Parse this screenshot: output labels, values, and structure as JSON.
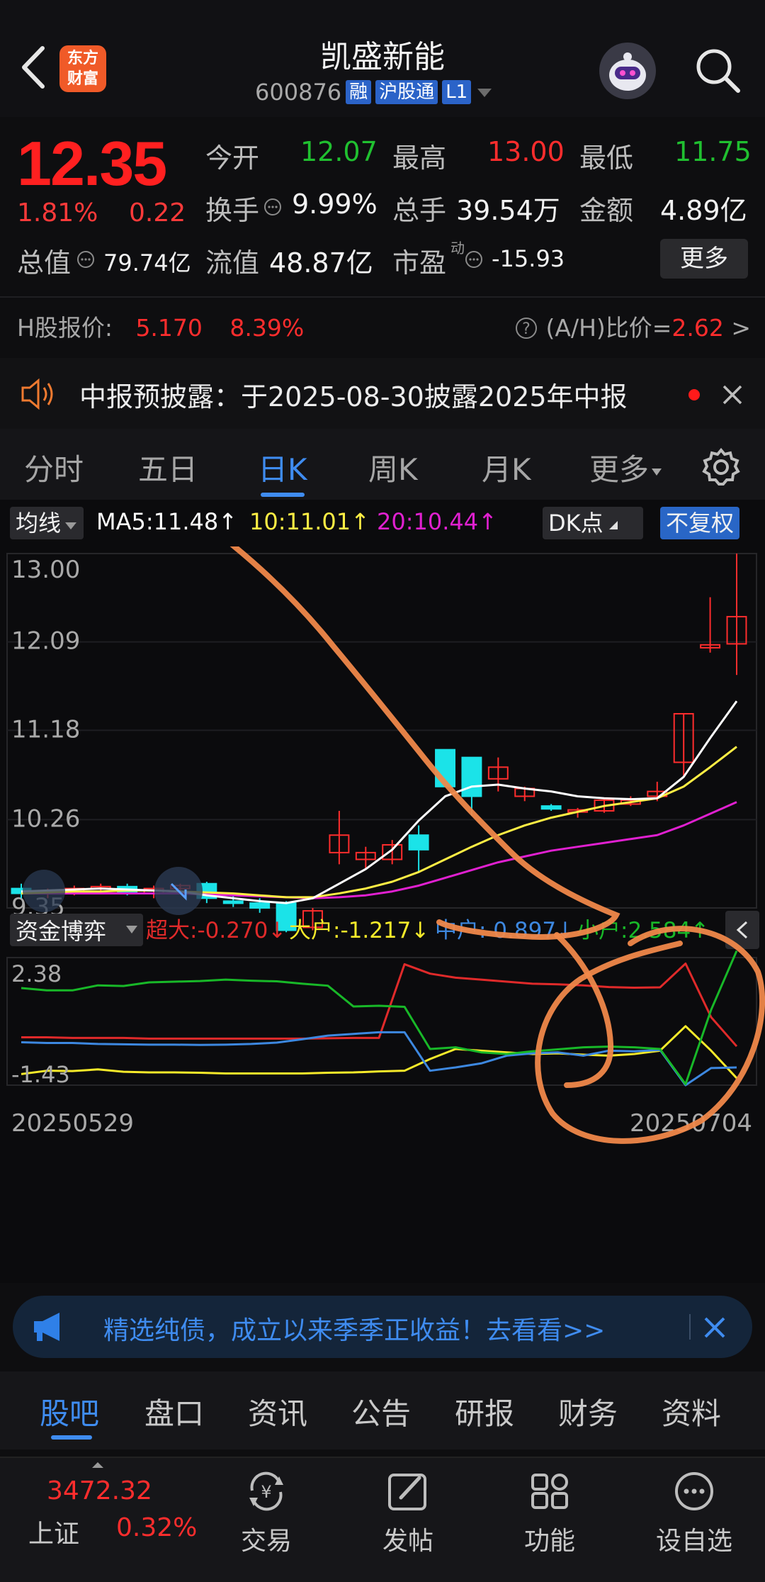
{
  "header": {
    "stock_name": "凯盛新能",
    "stock_code": "600876",
    "tags": [
      "融",
      "沪股通",
      "L1"
    ],
    "logo_text": [
      "东方",
      "财富"
    ]
  },
  "quote": {
    "price": "12.35",
    "change_pct": "1.81%",
    "change": "0.22",
    "rows": [
      [
        {
          "label": "今开",
          "value": "12.07",
          "color": "green"
        },
        {
          "label": "最高",
          "value": "13.00",
          "color": "red"
        },
        {
          "label": "最低",
          "value": "11.75",
          "color": "green"
        }
      ],
      [
        {
          "label": "换手",
          "value": "9.99%",
          "color": "white"
        },
        {
          "label": "总手",
          "value": "39.54万",
          "color": "white"
        },
        {
          "label": "金额",
          "value": "4.89亿",
          "color": "white"
        }
      ]
    ],
    "total_value_label": "总值",
    "total_value": "79.74亿",
    "float_value_label": "流值",
    "float_value": "48.87亿",
    "pe_label": "市盈",
    "pe_sup": "动",
    "pe_value": "-15.93",
    "more_label": "更多"
  },
  "hk": {
    "label": "H股报价:",
    "price": "5.170",
    "pct": "8.39%",
    "ratio_label": "(A/H)比价=",
    "ratio_value": "2.62",
    "arrow": ">"
  },
  "notice": {
    "text": "中报预披露：于2025-08-30披露2025年中报"
  },
  "kline_tabs": [
    "分时",
    "五日",
    "日K",
    "周K",
    "月K",
    "更多"
  ],
  "kline_active": "日K",
  "ma_bar": {
    "selector": "均线",
    "ma5": "MA5:11.48↑",
    "ma10": "10:11.01↑",
    "ma20": "20:10.44↑",
    "dk": "DK点",
    "adjust": "不复权"
  },
  "price_axis": [
    "13.00",
    "12.09",
    "11.18",
    "10.26",
    "9.35"
  ],
  "flow_bar": {
    "selector": "资金博弈",
    "super": "超大:-0.270↓",
    "big": "大户:-1.217↓",
    "mid": "中户: 0.897↓",
    "small": "小户:2.584↑"
  },
  "flow_axis": [
    "2.38",
    "-1.43"
  ],
  "date_axis": [
    "20250529",
    "20250704"
  ],
  "banner": {
    "text": "精选纯债，成立以来季季正收益！去看看>>"
  },
  "bottom_tabs": [
    "股吧",
    "盘口",
    "资讯",
    "公告",
    "研报",
    "财务",
    "资料"
  ],
  "bottom_tabs_active": "股吧",
  "nav": {
    "index_value": "3472.32",
    "index_name": "上证",
    "index_pct": "0.32%",
    "items": [
      "交易",
      "发帖",
      "功能",
      "设自选"
    ]
  },
  "colors": {
    "up": "#ff2d2d",
    "down": "#1be3e8",
    "ma5": "#ffffff",
    "ma10": "#ffee44",
    "ma20": "#e020d0",
    "super": "#e02a2a",
    "big": "#f6ea2a",
    "mid": "#3d88e0",
    "small": "#18b828",
    "accent": "#3f8cf0"
  },
  "chart_data": {
    "type": "candlestick",
    "ylim": [
      9.35,
      13.0
    ],
    "ohlc": [
      [
        9.55,
        9.6,
        9.45,
        9.5
      ],
      [
        9.5,
        9.55,
        9.45,
        9.52
      ],
      [
        9.52,
        9.58,
        9.48,
        9.55
      ],
      [
        9.55,
        9.6,
        9.5,
        9.57
      ],
      [
        9.57,
        9.6,
        9.48,
        9.5
      ],
      [
        9.5,
        9.58,
        9.45,
        9.55
      ],
      [
        9.55,
        9.6,
        9.5,
        9.58
      ],
      [
        9.6,
        9.62,
        9.4,
        9.45
      ],
      [
        9.42,
        9.48,
        9.36,
        9.4
      ],
      [
        9.4,
        9.45,
        9.3,
        9.35
      ],
      [
        9.4,
        9.42,
        9.1,
        9.12
      ],
      [
        9.15,
        9.35,
        9.12,
        9.32
      ],
      [
        9.92,
        10.35,
        9.8,
        10.1
      ],
      [
        9.85,
        9.98,
        9.75,
        9.92
      ],
      [
        9.85,
        10.05,
        9.8,
        10.0
      ],
      [
        10.1,
        10.2,
        9.72,
        9.95
      ],
      [
        10.98,
        10.98,
        10.6,
        10.6
      ],
      [
        10.9,
        10.9,
        10.3,
        10.5
      ],
      [
        10.68,
        10.9,
        10.55,
        10.8
      ],
      [
        10.5,
        10.6,
        10.45,
        10.58
      ],
      [
        10.4,
        10.42,
        10.35,
        10.37
      ],
      [
        10.36,
        10.38,
        10.28,
        10.36
      ],
      [
        10.35,
        10.48,
        10.33,
        10.46
      ],
      [
        10.42,
        10.5,
        10.4,
        10.46
      ],
      [
        10.5,
        10.65,
        10.45,
        10.55
      ],
      [
        10.85,
        11.35,
        10.7,
        11.35
      ],
      [
        12.03,
        12.55,
        11.98,
        12.06
      ],
      [
        12.07,
        13.0,
        11.75,
        12.35
      ]
    ],
    "ma5": [
      9.52,
      9.53,
      9.54,
      9.55,
      9.54,
      9.53,
      9.52,
      9.48,
      9.45,
      9.42,
      9.4,
      9.45,
      9.6,
      9.75,
      9.95,
      10.25,
      10.5,
      10.6,
      10.62,
      10.58,
      10.55,
      10.5,
      10.48,
      10.47,
      10.48,
      10.7,
      11.1,
      11.48
    ],
    "ma10": [
      9.5,
      9.51,
      9.52,
      9.52,
      9.53,
      9.53,
      9.52,
      9.51,
      9.5,
      9.48,
      9.46,
      9.46,
      9.5,
      9.55,
      9.62,
      9.72,
      9.85,
      9.98,
      10.1,
      10.2,
      10.28,
      10.34,
      10.4,
      10.44,
      10.48,
      10.6,
      10.8,
      11.01
    ],
    "ma20": [
      9.5,
      9.5,
      9.5,
      9.5,
      9.5,
      9.5,
      9.5,
      9.49,
      9.48,
      9.47,
      9.46,
      9.45,
      9.46,
      9.48,
      9.52,
      9.58,
      9.66,
      9.74,
      9.82,
      9.88,
      9.94,
      9.98,
      10.02,
      10.06,
      10.1,
      10.2,
      10.32,
      10.44
    ],
    "flow_ylim": [
      -1.43,
      2.38
    ],
    "flow_series": [
      {
        "name": "超大",
        "values": [
          0.0,
          0.0,
          -0.02,
          -0.02,
          -0.02,
          -0.04,
          -0.04,
          -0.04,
          -0.04,
          -0.04,
          -0.04,
          -0.04,
          -0.03,
          -0.02,
          -0.02,
          2.18,
          1.9,
          1.78,
          1.72,
          1.66,
          1.6,
          1.58,
          1.55,
          1.5,
          1.48,
          1.49,
          2.2,
          0.6,
          -0.27
        ]
      },
      {
        "name": "大户",
        "values": [
          -1.1,
          -1.0,
          -1.01,
          -0.96,
          -1.03,
          -1.05,
          -1.05,
          -1.06,
          -1.08,
          -1.08,
          -1.08,
          -1.08,
          -1.06,
          -1.05,
          -1.02,
          -1.0,
          -0.65,
          -0.35,
          -0.4,
          -0.45,
          -0.5,
          -0.48,
          -0.52,
          -0.55,
          -0.5,
          -0.4,
          0.33,
          -0.4,
          -1.22
        ]
      },
      {
        "name": "中户",
        "values": [
          -0.15,
          -0.17,
          -0.17,
          -0.2,
          -0.21,
          -0.22,
          -0.22,
          -0.23,
          -0.22,
          -0.2,
          -0.16,
          -0.06,
          0.05,
          0.1,
          0.15,
          0.15,
          -1.0,
          -0.9,
          -0.78,
          -0.55,
          -0.48,
          -0.45,
          -0.55,
          -0.4,
          -0.42,
          -0.38,
          -1.43,
          -0.92,
          -0.9
        ]
      },
      {
        "name": "小户",
        "values": [
          1.47,
          1.4,
          1.4,
          1.55,
          1.53,
          1.64,
          1.66,
          1.68,
          1.72,
          1.69,
          1.67,
          1.6,
          1.54,
          0.92,
          0.94,
          0.91,
          -0.35,
          -0.3,
          -0.45,
          -0.5,
          -0.42,
          -0.36,
          -0.3,
          -0.28,
          -0.3,
          -0.35,
          -1.4,
          0.82,
          2.58
        ]
      }
    ]
  }
}
